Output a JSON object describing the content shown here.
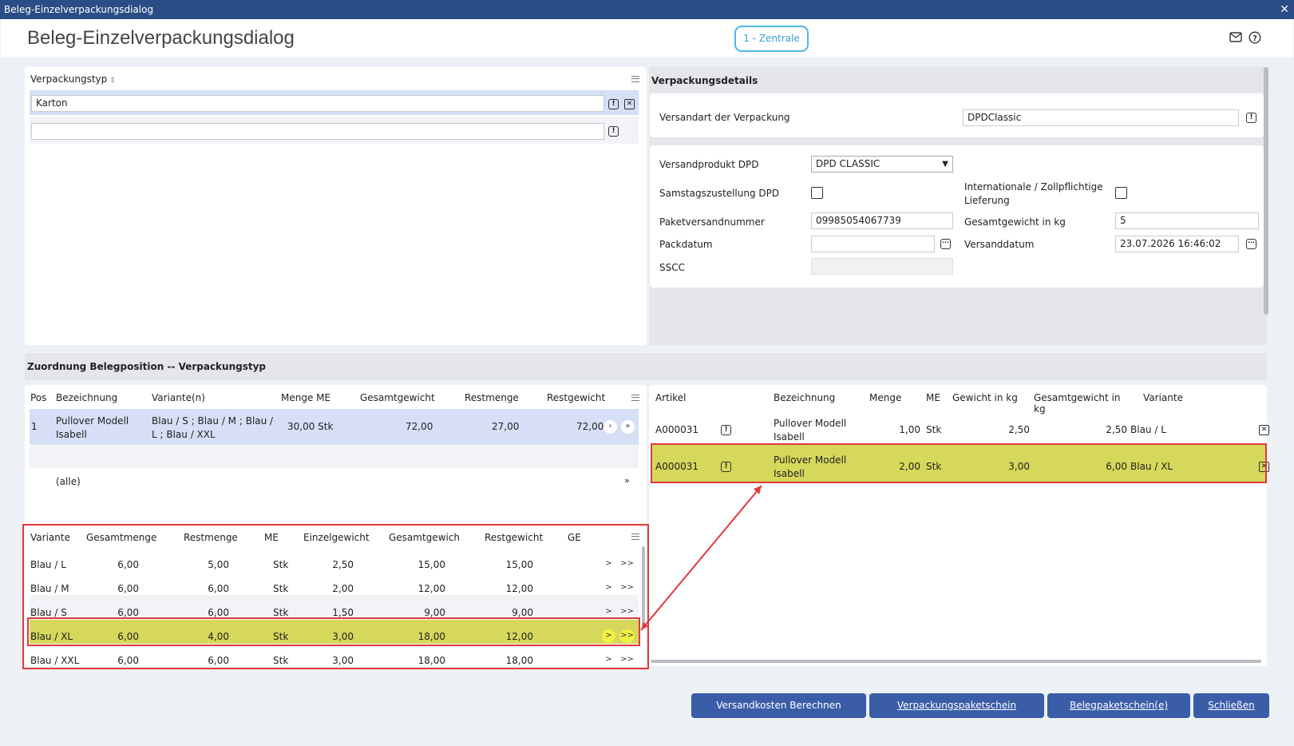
{
  "window": {
    "title": "Beleg-Einzelverpackungsdialog",
    "close": "✕"
  },
  "page": {
    "title": "Beleg-Einzelverpackungsdialog",
    "branch": "1 - Zentrale"
  },
  "verpackungstyp": {
    "header": "Verpackungstyp",
    "value1": "Karton",
    "value2": ""
  },
  "details": {
    "title": "Verpackungsdetails",
    "versandart_label": "Versandart der Verpackung",
    "versandart_value": "DPDClassic",
    "versandprodukt_label": "Versandprodukt DPD",
    "versandprodukt_value": "DPD CLASSIC",
    "samstag_label": "Samstagszustellung DPD",
    "international_label1": "Internationale / Zollpflichtige",
    "international_label2": "Lieferung",
    "paketnr_label": "Paketversandnummer",
    "paketnr_value": "09985054067739",
    "gewicht_label": "Gesamtgewicht in kg",
    "gewicht_value": "5",
    "packdatum_label": "Packdatum",
    "packdatum_value": "",
    "versanddatum_label": "Versanddatum",
    "versanddatum_value": "23.07.2026 16:46:02",
    "sscc_label": "SSCC",
    "sscc_value": ""
  },
  "zuordnung": {
    "title": "Zuordnung Belegposition -- Verpackungstyp"
  },
  "pos_table": {
    "headers": [
      "Pos",
      "Bezeichnung",
      "Variante(n)",
      "Menge ME",
      "Gesamtgewicht",
      "Restmenge",
      "Restgewicht"
    ],
    "row": {
      "pos": "1",
      "bez1": "Pullover Modell",
      "bez2": "Isabell",
      "var1": "Blau / S ; Blau / M ; Blau /",
      "var2": "L ; Blau / XXL",
      "menge": "30,00 Stk",
      "gesamtgewicht": "72,00",
      "restmenge": "27,00",
      "restgewicht": "72,00"
    },
    "alle": "(alle)"
  },
  "variant_table": {
    "headers": [
      "Variante",
      "Gesamtmenge",
      "Restmenge",
      "ME",
      "Einzelgewicht",
      "Gesamtgewich",
      "Restgewicht",
      "GE"
    ],
    "rows": [
      {
        "variante": "Blau / L",
        "gesamt": "6,00",
        "rest": "5,00",
        "me": "Stk",
        "einzel": "2,50",
        "gesgew": "15,00",
        "restgew": "15,00"
      },
      {
        "variante": "Blau / M",
        "gesamt": "6,00",
        "rest": "6,00",
        "me": "Stk",
        "einzel": "2,00",
        "gesgew": "12,00",
        "restgew": "12,00"
      },
      {
        "variante": "Blau / S",
        "gesamt": "6,00",
        "rest": "6,00",
        "me": "Stk",
        "einzel": "1,50",
        "gesgew": "9,00",
        "restgew": "9,00"
      },
      {
        "variante": "Blau / XL",
        "gesamt": "6,00",
        "rest": "4,00",
        "me": "Stk",
        "einzel": "3,00",
        "gesgew": "18,00",
        "restgew": "12,00"
      },
      {
        "variante": "Blau / XXL",
        "gesamt": "6,00",
        "rest": "6,00",
        "me": "Stk",
        "einzel": "3,00",
        "gesgew": "18,00",
        "restgew": "18,00"
      }
    ],
    "btn_one": ">",
    "btn_all": ">>"
  },
  "article_table": {
    "headers": [
      "Artikel",
      "Bezeichnung",
      "Menge",
      "ME",
      "Gewicht in kg",
      "Gesamtgewicht in kg",
      "Variante"
    ],
    "rows": [
      {
        "artikel": "A000031",
        "bez1": "Pullover Modell",
        "bez2": "Isabell",
        "menge": "1,00",
        "me": "Stk",
        "gewicht": "2,50",
        "gesgew": "2,50",
        "variante": "Blau / L"
      },
      {
        "artikel": "A000031",
        "bez1": "Pullover Modell",
        "bez2": "Isabell",
        "menge": "2,00",
        "me": "Stk",
        "gewicht": "3,00",
        "gesgew": "6,00",
        "variante": "Blau / XL"
      }
    ]
  },
  "buttons": {
    "versandkosten": "Versandkosten Berechnen",
    "verpackungsschein": "Verpackungspaketschein",
    "belegschein": "Belegpaketschein(e)",
    "schliessen": "Schließen"
  },
  "colors": {
    "titlebar": "#2b4d86",
    "accent": "#3b5da8",
    "highlight": "#d5d85a",
    "annotation": "#e0393e"
  }
}
